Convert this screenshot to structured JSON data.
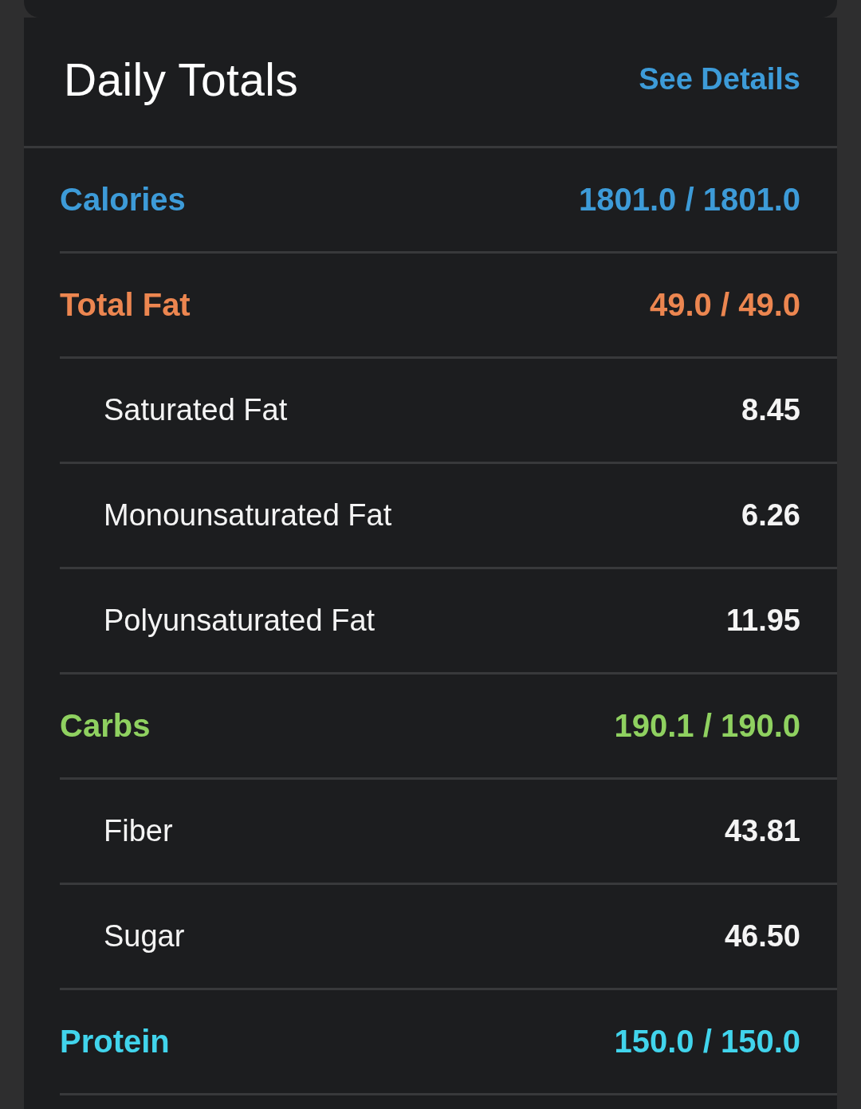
{
  "header": {
    "title": "Daily Totals",
    "link": "See Details"
  },
  "nutrients": [
    {
      "name": "Calories",
      "value": "1801.0 / 1801.0",
      "color": "#3d9bd8"
    },
    {
      "name": "Total Fat",
      "value": "49.0 / 49.0",
      "color": "#ec8650",
      "children": [
        {
          "name": "Saturated Fat",
          "value": "8.45"
        },
        {
          "name": "Monounsaturated Fat",
          "value": "6.26"
        },
        {
          "name": "Polyunsaturated Fat",
          "value": "11.95"
        }
      ]
    },
    {
      "name": "Carbs",
      "value": "190.1 / 190.0",
      "color": "#8fd160",
      "children": [
        {
          "name": "Fiber",
          "value": "43.81"
        },
        {
          "name": "Sugar",
          "value": "46.50"
        }
      ]
    },
    {
      "name": "Protein",
      "value": "150.0 / 150.0",
      "color": "#41d4ec"
    }
  ]
}
